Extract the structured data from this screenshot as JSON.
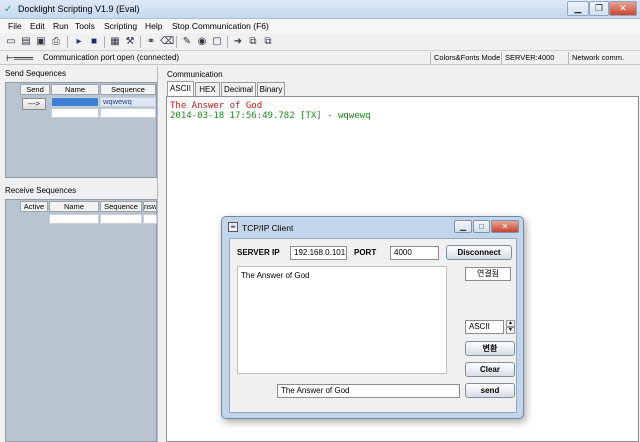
{
  "app": {
    "title": "Docklight Scripting V1.9 (Eval)",
    "menu": [
      "File",
      "Edit",
      "Run",
      "Tools",
      "Scripting",
      "Help",
      "Stop Communication  (F6)"
    ],
    "status": {
      "port_message": "Communication port open (connected)",
      "colors_fonts": "Colors&Fonts Mode",
      "server": "SERVER:4000",
      "network": "Network comm."
    }
  },
  "send_sequences": {
    "label": "Send Sequences",
    "columns": [
      "Send",
      "Name",
      "Sequence"
    ],
    "rows": [
      {
        "send_button": "--->",
        "name": "",
        "sequence": "wqwewq"
      }
    ]
  },
  "receive_sequences": {
    "label": "Receive Sequences",
    "columns": [
      "Active",
      "Name",
      "Sequence",
      "nsw"
    ]
  },
  "communication": {
    "label": "Communication",
    "tabs": [
      "ASCII",
      "HEX",
      "Decimal",
      "Binary"
    ],
    "active_tab": "ASCII",
    "lines": [
      {
        "text": "The Answer of God",
        "color": "#c01818"
      },
      {
        "text": "2014-03-18 17:56:49.782 [TX] - wqwewq",
        "color": "#1e8a1e"
      }
    ]
  },
  "dialog": {
    "title": "TCP/IP Client",
    "server_ip_label": "SERVER IP",
    "server_ip_value": "192.168.0.101",
    "port_label": "PORT",
    "port_value": "4000",
    "disconnect_label": "Disconnect",
    "received_text": "The Answer of God",
    "connected_status": "연결됨",
    "encoding_value": "ASCII",
    "convert_label": "변환",
    "clear_label": "Clear",
    "send_input_value": "The Answer of God",
    "send_label": "send"
  },
  "colors": {
    "titlebar": "#c6d9ef",
    "panel_grid": "#b8c4cf",
    "selected_cell": "#3c7fd4",
    "dialog_frame": "#c2d5ea"
  }
}
